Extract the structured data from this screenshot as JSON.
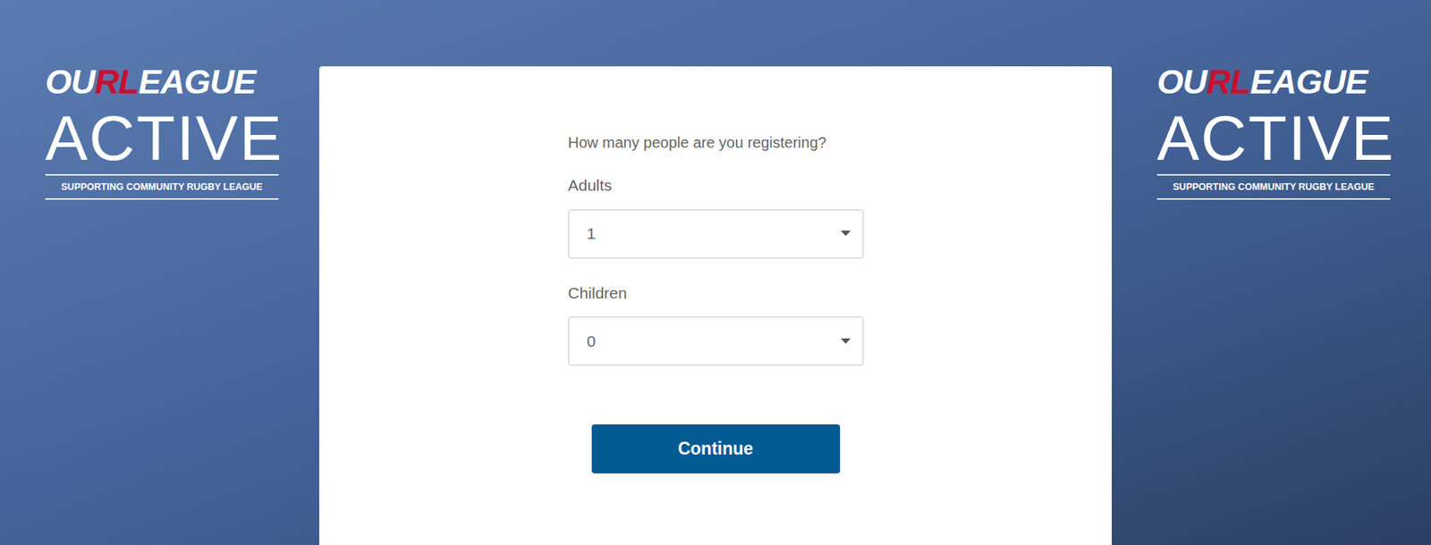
{
  "logos": [
    {
      "title_parts": [
        {
          "text": "OU",
          "color": "#ffffff"
        },
        {
          "text": "RL",
          "color": "#c8102e"
        },
        {
          "text": "EAGUE",
          "color": "#ffffff"
        }
      ],
      "subtitle": "ACTIVE",
      "tagline": "SUPPORTING COMMUNITY RUGBY LEAGUE"
    },
    {
      "title_parts": [
        {
          "text": "OU",
          "color": "#ffffff"
        },
        {
          "text": "RL",
          "color": "#c8102e"
        },
        {
          "text": "EAGUE",
          "color": "#ffffff"
        }
      ],
      "subtitle": "ACTIVE",
      "tagline": "SUPPORTING COMMUNITY RUGBY LEAGUE"
    }
  ],
  "form": {
    "question": "How many people are you registering?",
    "fields": [
      {
        "label": "Adults",
        "value": "1"
      },
      {
        "label": "Children",
        "value": "0"
      }
    ],
    "button": "Continue"
  }
}
